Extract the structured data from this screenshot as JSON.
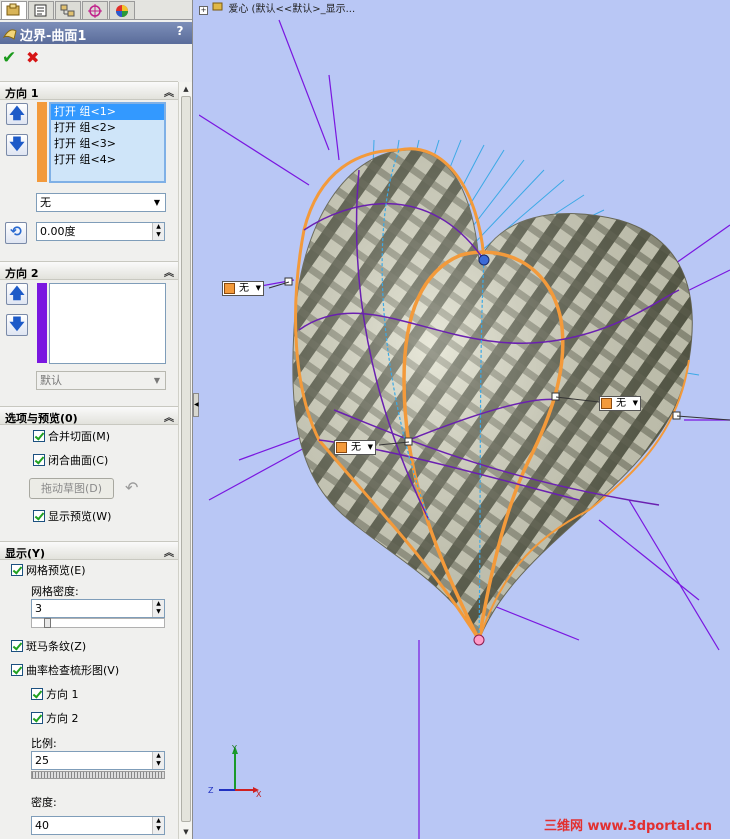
{
  "property_manager": {
    "title": "边界-曲面1",
    "help": "?",
    "ok_icon": "checkmark-icon",
    "cancel_icon": "cross-icon",
    "direction1": {
      "header": "方向 1",
      "items": [
        "打开 组<1>",
        "打开 组<2>",
        "打开 组<3>",
        "打开 组<4>"
      ],
      "tangency": "无",
      "angle": "0.00度",
      "color": "#f39a3b"
    },
    "direction2": {
      "header": "方向 2",
      "items": [],
      "tangency": "默认",
      "color": "#7a17e0"
    },
    "options": {
      "header": "选项与预览(0)",
      "merge_faces": "合并切面(M)",
      "closed_surface": "闭合曲面(C)",
      "drag_sketch": "拖动草图(D)",
      "show_preview": "显示预览(W)"
    },
    "display": {
      "header": "显示(Y)",
      "mesh_preview": "网格预览(E)",
      "mesh_density_label": "网格密度:",
      "mesh_density": "3",
      "zebra": "斑马条纹(Z)",
      "curvature_comb": "曲率检查梳形图(V)",
      "dir1": "方向 1",
      "dir2": "方向 2",
      "scale_label": "比例:",
      "scale": "25",
      "density_label": "密度:",
      "density": "40"
    }
  },
  "viewport": {
    "breadcrumb": "爱心 (默认<<默认>_显示...",
    "callouts": [
      "无",
      "无",
      "无"
    ],
    "axis_labels": {
      "y": "Y",
      "z": "Z",
      "x": "X"
    },
    "watermark": "三维网 www.3dportal.cn"
  },
  "colors": {
    "viewport_bg": "#b9c7f5",
    "boundary_orange": "#f39a3b",
    "comb_purple": "#7a17e0",
    "comb_blue": "#3ba9e6",
    "zebra_dark": "#5d604c",
    "zebra_light": "#dcdcc6"
  }
}
